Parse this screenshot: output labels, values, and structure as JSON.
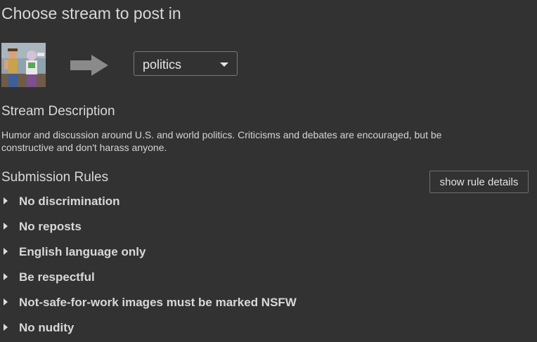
{
  "header": {
    "title": "Choose stream to post in"
  },
  "stream_selector": {
    "thumbnail_icon": "stream-thumbnail-image",
    "arrow_icon": "right-arrow-icon",
    "selected_value": "politics"
  },
  "description": {
    "heading": "Stream Description",
    "text": "Humor and discussion around U.S. and world politics. Criticisms and debates are encouraged, but be constructive and don't harass anyone."
  },
  "rules": {
    "heading": "Submission Rules",
    "details_button_label": "show rule details",
    "items": [
      {
        "label": "No discrimination"
      },
      {
        "label": "No reposts"
      },
      {
        "label": "English language only"
      },
      {
        "label": "Be respectful"
      },
      {
        "label": "Not-safe-for-work images must be marked NSFW"
      },
      {
        "label": "No nudity"
      }
    ]
  },
  "colors": {
    "background": "#333232",
    "text": "#d8d8d8",
    "arrow": "#8a8a8a"
  }
}
